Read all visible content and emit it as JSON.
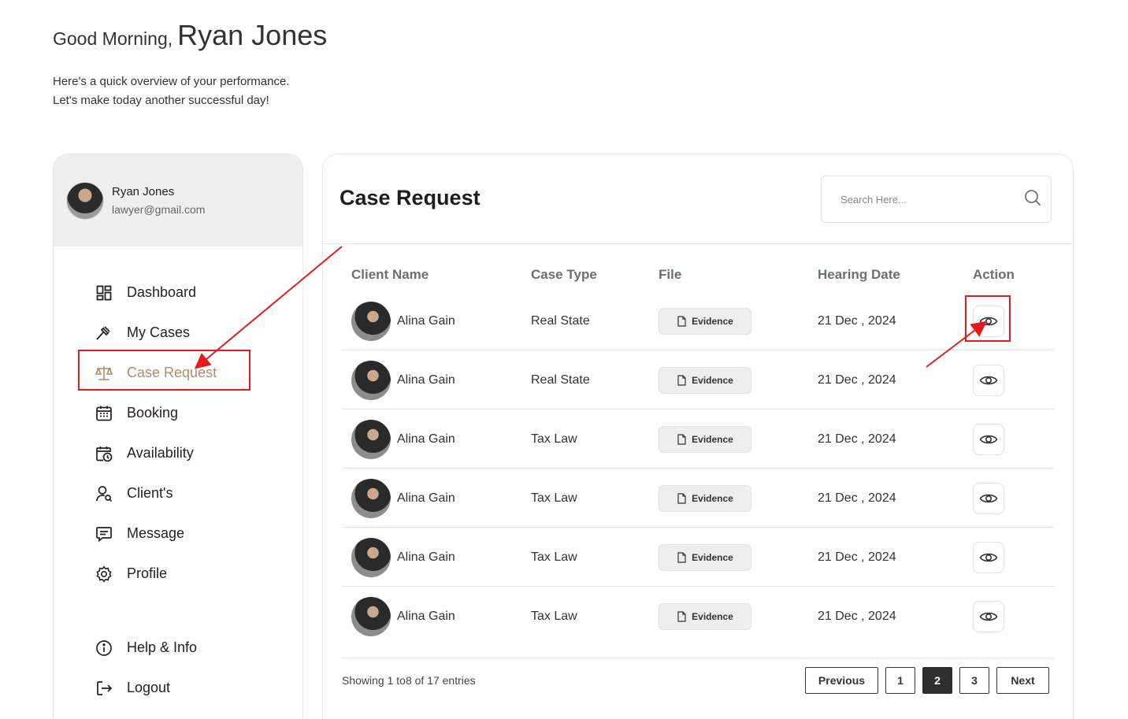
{
  "header": {
    "greeting": "Good Morning,",
    "user_name": "Ryan Jones",
    "subtitle_line1": "Here's a quick overview of your performance.",
    "subtitle_line2": "Let's make today another successful day!"
  },
  "sidebar": {
    "profile": {
      "name": "Ryan Jones",
      "email": "lawyer@gmail.com"
    },
    "items": [
      {
        "label": "Dashboard",
        "icon": "dashboard-icon"
      },
      {
        "label": "My Cases",
        "icon": "gavel-icon"
      },
      {
        "label": "Case Request",
        "icon": "scale-icon",
        "active": true
      },
      {
        "label": "Booking",
        "icon": "calendar-icon"
      },
      {
        "label": "Availability",
        "icon": "calendar-clock-icon"
      },
      {
        "label": "Client's",
        "icon": "user-search-icon"
      },
      {
        "label": "Message",
        "icon": "message-icon"
      },
      {
        "label": "Profile",
        "icon": "gear-icon"
      }
    ],
    "bottom_items": [
      {
        "label": "Help & Info",
        "icon": "info-icon"
      },
      {
        "label": "Logout",
        "icon": "logout-icon"
      }
    ],
    "active_color": "#b08c6a"
  },
  "main": {
    "title": "Case Request",
    "search": {
      "placeholder": "Search Here..."
    },
    "columns": [
      "Client Name",
      "Case Type",
      "File",
      "Hearing Date",
      "Action"
    ],
    "rows": [
      {
        "client": "Alina Gain",
        "case_type": "Real State",
        "file": "Evidence",
        "date": "21 Dec , 2024"
      },
      {
        "client": "Alina Gain",
        "case_type": "Real State",
        "file": "Evidence",
        "date": "21 Dec , 2024"
      },
      {
        "client": "Alina Gain",
        "case_type": "Tax Law",
        "file": "Evidence",
        "date": "21 Dec , 2024"
      },
      {
        "client": "Alina Gain",
        "case_type": "Tax Law",
        "file": "Evidence",
        "date": "21 Dec , 2024"
      },
      {
        "client": "Alina Gain",
        "case_type": "Tax Law",
        "file": "Evidence",
        "date": "21 Dec , 2024"
      },
      {
        "client": "Alina Gain",
        "case_type": "Tax Law",
        "file": "Evidence",
        "date": "21 Dec , 2024"
      }
    ],
    "footer": {
      "showing": "Showing 1  to8  of 17 entries",
      "prev": "Previous",
      "pages": [
        "1",
        "2",
        "3"
      ],
      "active_page": "2",
      "next": "Next"
    }
  },
  "annotation_color": "#e31b1b"
}
